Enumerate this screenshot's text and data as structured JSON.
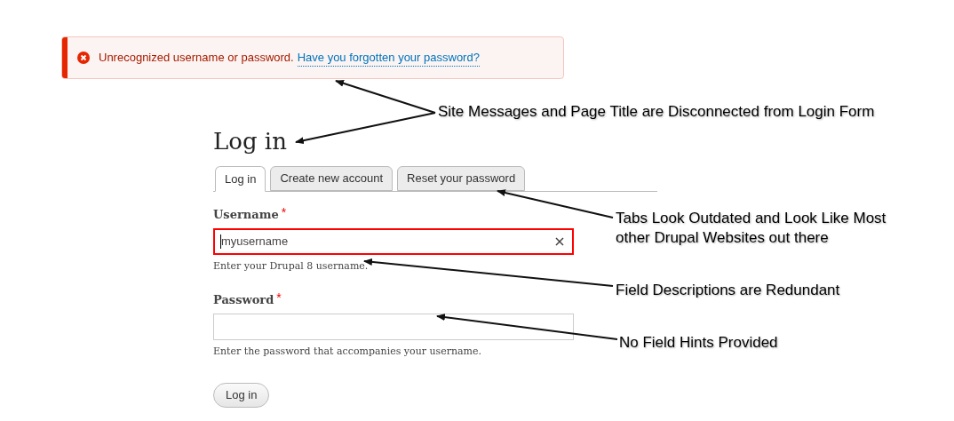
{
  "message": {
    "kind": "error",
    "text": "Unrecognized username or password.",
    "link": "Have you forgotten your password?"
  },
  "title": "Log in",
  "tabs": [
    {
      "label": "Log in",
      "selected": true
    },
    {
      "label": "Create new account",
      "selected": false
    },
    {
      "label": "Reset your password",
      "selected": false
    }
  ],
  "fields": [
    {
      "label": "Username",
      "required_mark": "*",
      "value": "myusername",
      "error": true,
      "description": "Enter your Drupal 8 username."
    },
    {
      "label": "Password",
      "required_mark": "*",
      "error": false,
      "description": "Enter the password that accompanies your username."
    }
  ],
  "button": "Log in",
  "annotations": [
    {
      "lines": [
        "Site Messages and Page Title are Disconnected from Login Form"
      ]
    },
    {
      "lines": [
        "Tabs Look Outdated and Look Like Most",
        "other Drupal Websites out there"
      ]
    },
    {
      "lines": [
        "Field Descriptions are Redundant"
      ]
    },
    {
      "lines": [
        "No Field Hints Provided"
      ]
    }
  ]
}
